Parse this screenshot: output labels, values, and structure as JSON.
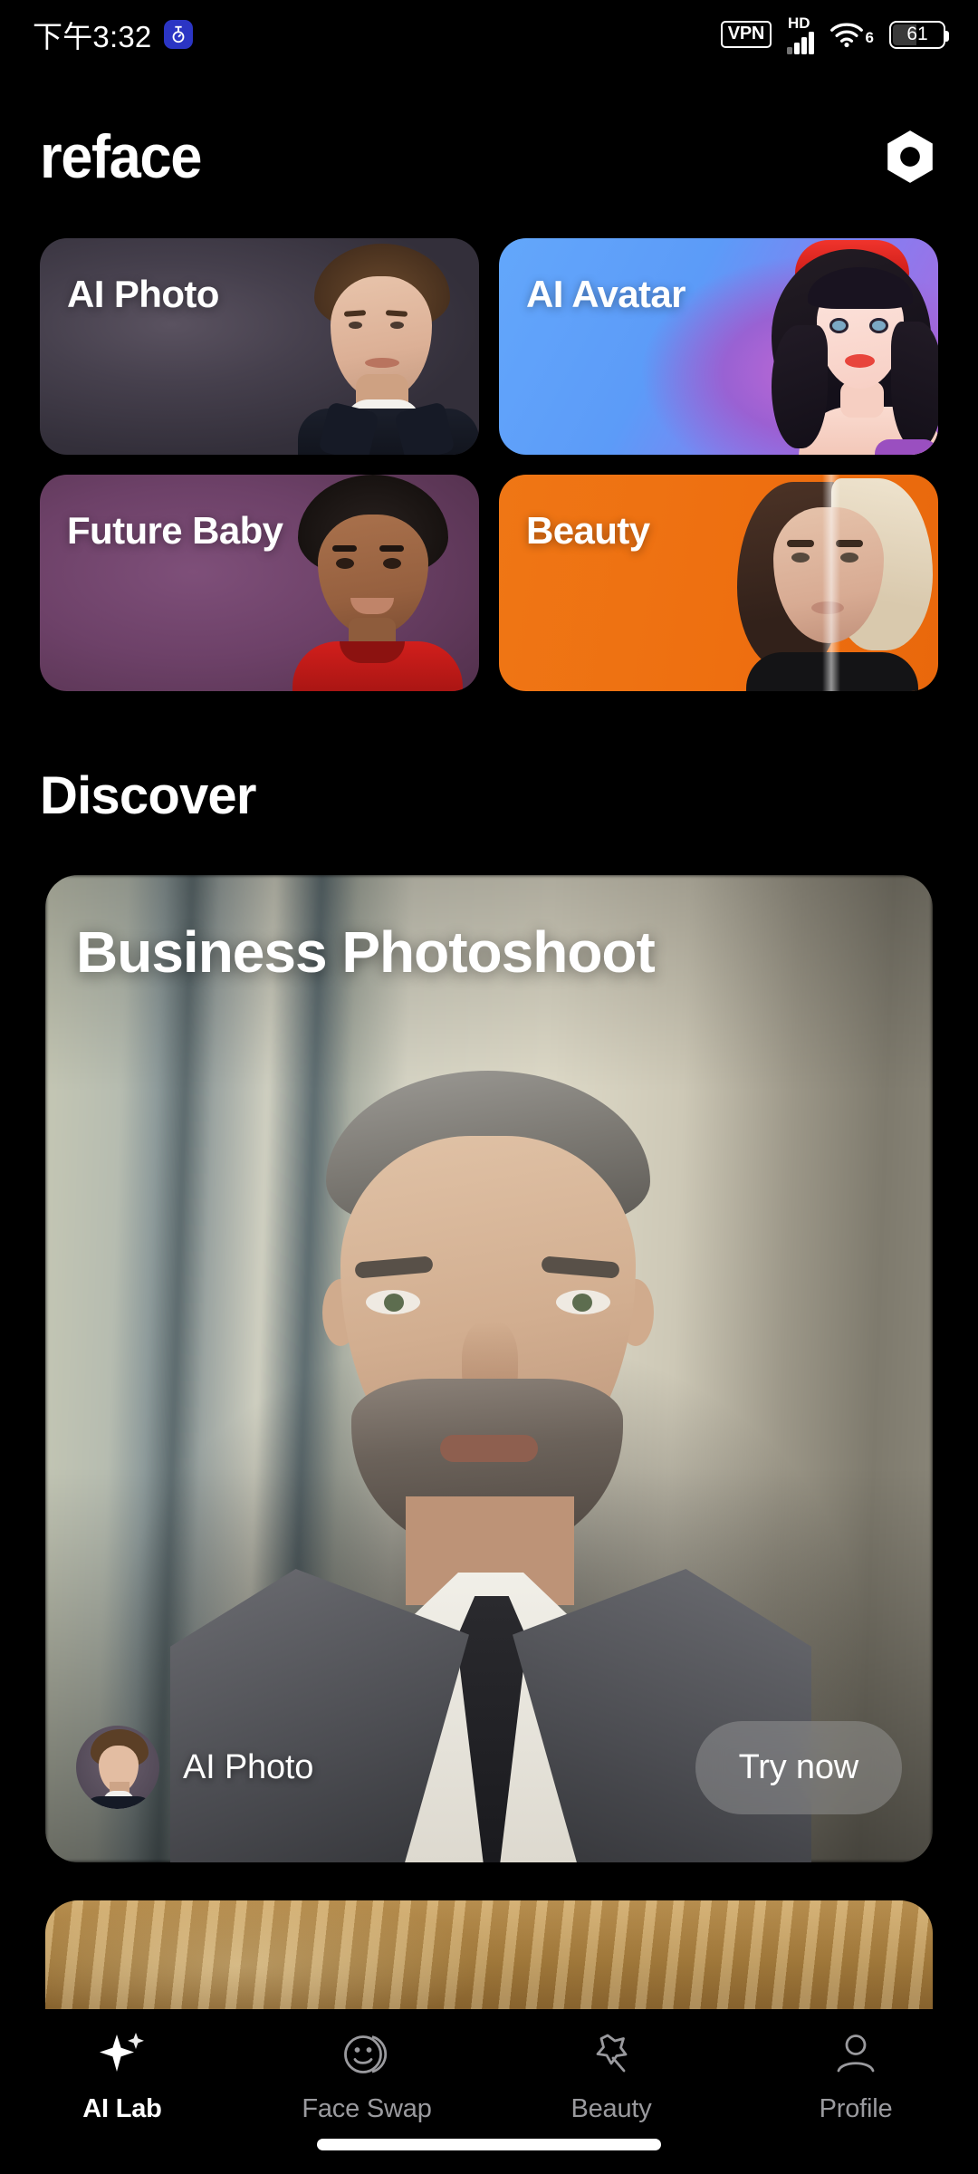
{
  "status_bar": {
    "clock": "下午3:32",
    "app_icon": "timer-icon",
    "vpn_label": "VPN",
    "network_type": "HD",
    "wifi_generation": "6",
    "battery_percent": "61"
  },
  "header": {
    "wordmark": "reface",
    "logo_icon": "hexagon-nut-icon"
  },
  "categories": [
    {
      "label": "AI Photo",
      "theme": "#46404d",
      "art": "young-man-portrait"
    },
    {
      "label": "AI Avatar",
      "theme": "#63a7fb",
      "art": "cartoon-woman-avatar"
    },
    {
      "label": "Future Baby",
      "theme": "#6d4168",
      "art": "smiling-child-portrait"
    },
    {
      "label": "Beauty",
      "theme": "#ee6f10",
      "art": "split-face-beauty"
    }
  ],
  "discover": {
    "section_title": "Discover",
    "hero": {
      "title": "Business Photoshoot",
      "art": "businessman-in-suit",
      "avatar_icon": "ai-photo-thumbnail",
      "subtitle": "AI Photo",
      "cta_label": "Try now"
    },
    "next_card_preview": "golden-card-peek"
  },
  "bottom_nav": {
    "active_index": 0,
    "items": [
      {
        "label": "AI Lab",
        "icon": "sparkle-icon"
      },
      {
        "label": "Face Swap",
        "icon": "face-swap-icon"
      },
      {
        "label": "Beauty",
        "icon": "magic-wand-icon"
      },
      {
        "label": "Profile",
        "icon": "person-icon"
      }
    ]
  }
}
